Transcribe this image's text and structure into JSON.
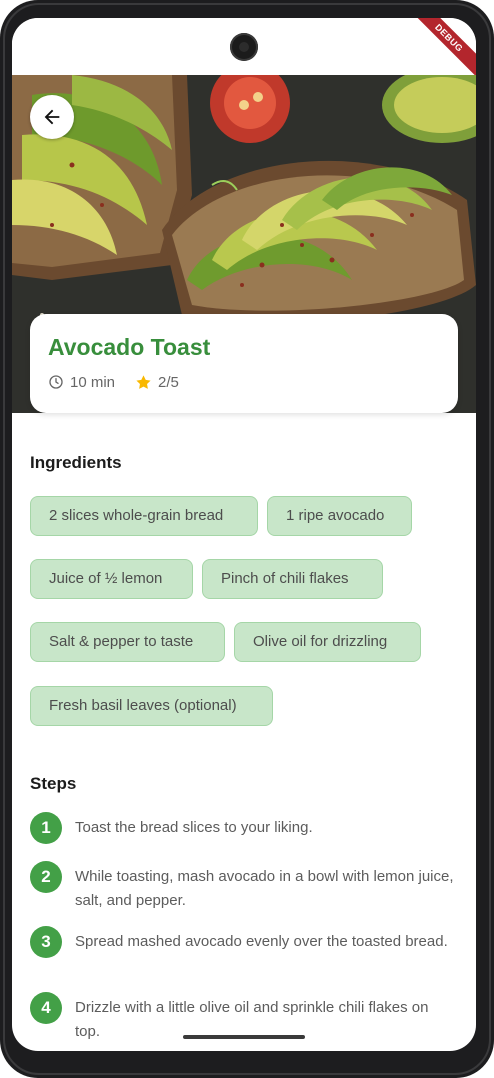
{
  "status_bar": {
    "debug_label": "DEBUG"
  },
  "recipe": {
    "title": "Avocado Toast",
    "time": "10 min",
    "rating": "2/5"
  },
  "ingredients": {
    "heading": "Ingredients",
    "items": [
      "2 slices whole-grain bread",
      "1 ripe avocado",
      "Juice of ½ lemon",
      "Pinch of chili flakes",
      "Salt & pepper to taste",
      "Olive oil for drizzling",
      "Fresh basil leaves (optional)"
    ]
  },
  "steps": {
    "heading": "Steps",
    "items": [
      {
        "number": "1",
        "text": "Toast the bread slices to your liking."
      },
      {
        "number": "2",
        "text": "While toasting, mash avocado in a bowl with lemon juice, salt, and pepper."
      },
      {
        "number": "3",
        "text": "Spread mashed avocado evenly over the toasted bread."
      },
      {
        "number": "4",
        "text": "Drizzle with a little olive oil and sprinkle chili flakes on top."
      }
    ]
  },
  "colors": {
    "accent_green": "#388e3c",
    "step_badge": "#43a047",
    "chip_bg": "#c8e6c9",
    "star": "#f9b800"
  },
  "icons": {
    "back": "arrow-left-icon",
    "time": "clock-icon",
    "rating": "star-icon"
  }
}
